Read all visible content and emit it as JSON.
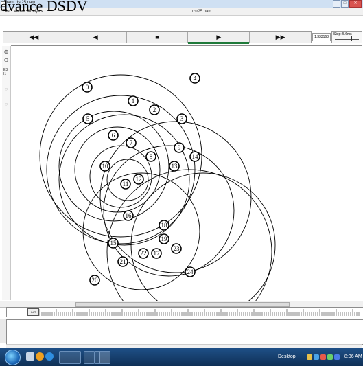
{
  "overlay_caption": "dvance DSDV",
  "window": {
    "title": "nam: dsr25.nam",
    "buttons": {
      "minimize": "–",
      "maximize": "□",
      "close": "✕"
    }
  },
  "menubar": {
    "items": [
      "File",
      "Views",
      "Analysis"
    ],
    "filename": "dsr25.nam"
  },
  "controls": {
    "rewind": "◀◀",
    "back": "◀",
    "stop": "■",
    "play": "▶",
    "fast_forward": "▶▶",
    "time": "1.333168",
    "step_label": "Step: 5.6ms"
  },
  "side_tools": [
    "zoom-in-icon",
    "zoom-out-icon"
  ],
  "side_text": [
    "E3",
    "I1"
  ],
  "nodes": [
    {
      "label": "0"
    },
    {
      "label": "1"
    },
    {
      "label": "2"
    },
    {
      "label": "3"
    },
    {
      "label": "4"
    },
    {
      "label": "5"
    },
    {
      "label": "6"
    },
    {
      "label": "7"
    },
    {
      "label": "8"
    },
    {
      "label": "9"
    },
    {
      "label": "10"
    },
    {
      "label": "11"
    },
    {
      "label": "12"
    },
    {
      "label": "13"
    },
    {
      "label": "14"
    },
    {
      "label": "15"
    },
    {
      "label": "16"
    },
    {
      "label": "17"
    },
    {
      "label": "18"
    },
    {
      "label": "19"
    },
    {
      "label": "20"
    },
    {
      "label": "21"
    },
    {
      "label": "22"
    },
    {
      "label": "23"
    },
    {
      "label": "24"
    }
  ],
  "ruler_button": "INIT",
  "taskbar": {
    "desktop_label": "Desktop",
    "clock": "8:36 AM",
    "colors": {
      "start": "#1c68b8",
      "bar": "#0f3056"
    }
  }
}
